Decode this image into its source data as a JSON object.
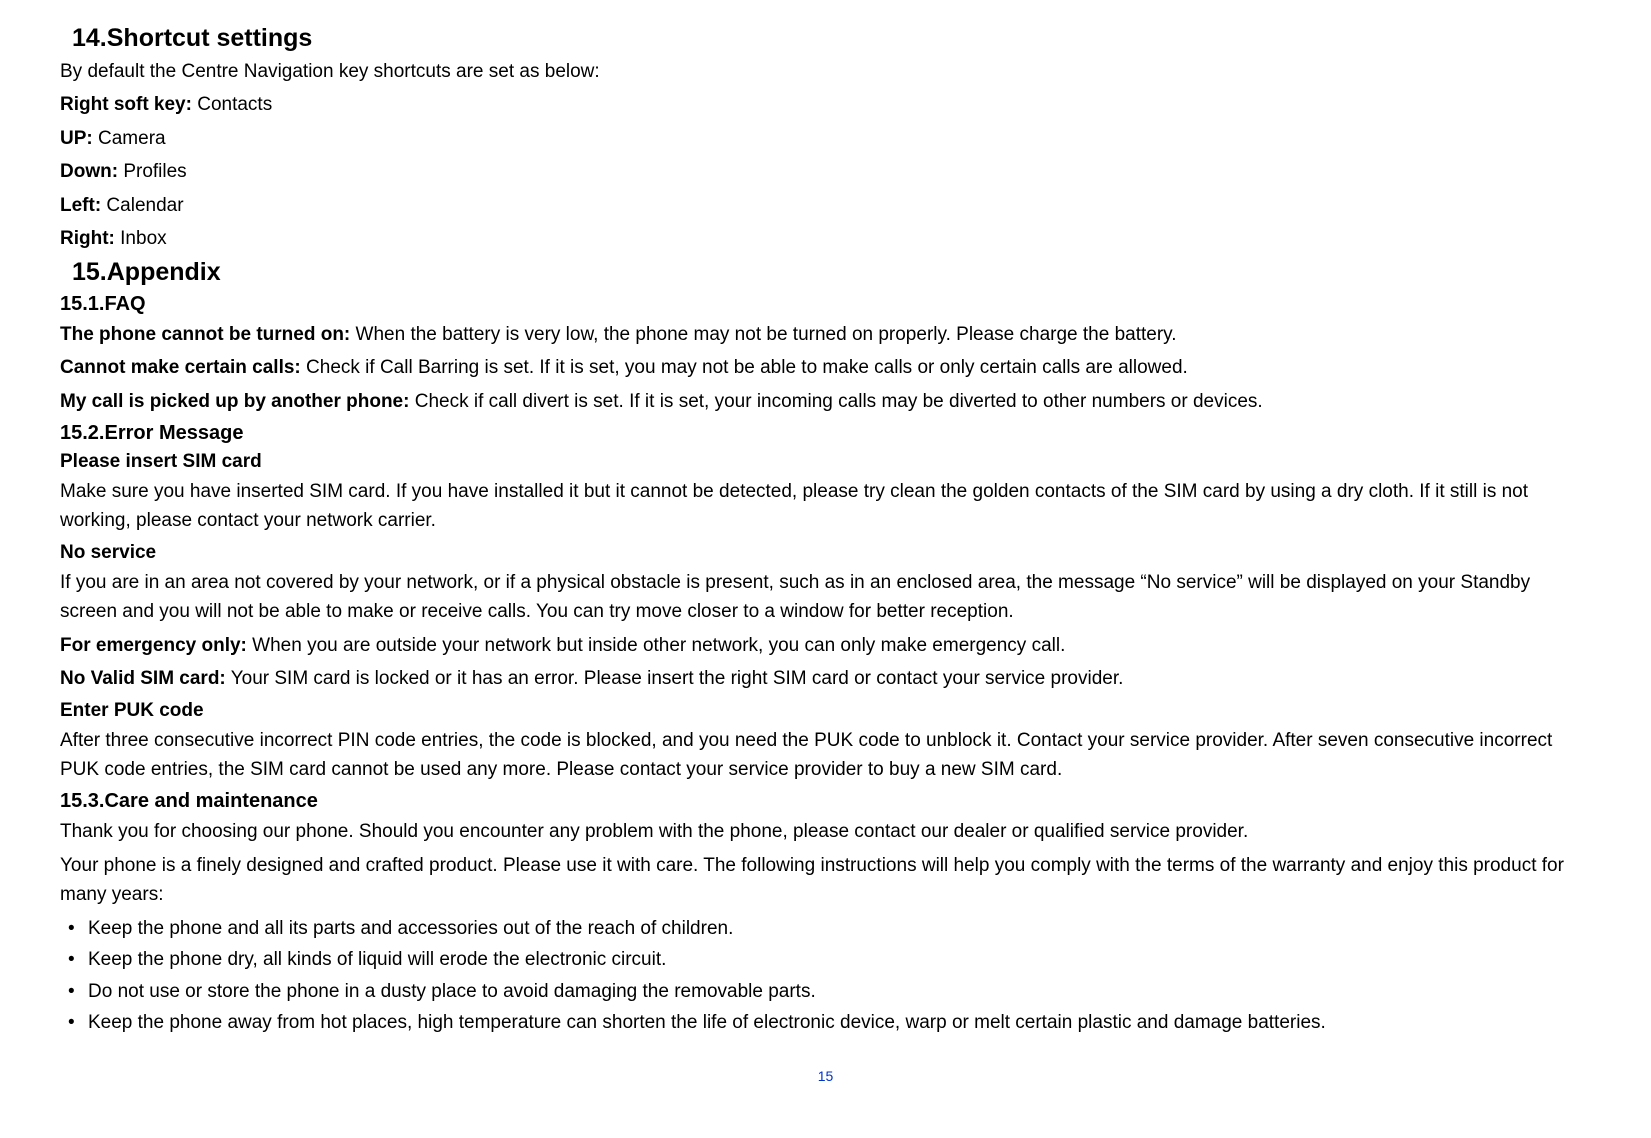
{
  "s14": {
    "title": "14.Shortcut  settings",
    "intro": "By default the Centre Navigation key shortcuts are set as below:",
    "rows": [
      {
        "label": "Right soft key:",
        "value": " Contacts"
      },
      {
        "label": "UP:",
        "value": " Camera"
      },
      {
        "label": "Down:",
        "value": " Profiles"
      },
      {
        "label": "Left:",
        "value": " Calendar"
      },
      {
        "label": "Right:",
        "value": " Inbox"
      }
    ]
  },
  "s15": {
    "title": "15.Appendix",
    "faq": {
      "heading": "15.1.FAQ",
      "items": [
        {
          "label": "The phone cannot be turned on:",
          "text": " When the battery is very low, the phone may not be turned on properly. Please charge the battery."
        },
        {
          "label": "Cannot make certain calls:",
          "text": " Check if Call Barring is set. If it is set, you may not be able to make calls or only certain calls are allowed."
        },
        {
          "label": "My call is picked up by another phone:",
          "text": " Check if call divert is set. If it is set, your incoming calls may be diverted to other numbers or devices."
        }
      ]
    },
    "err": {
      "heading": "15.2.Error Message",
      "sim": {
        "heading": "Please insert SIM card",
        "text": "Make sure you have inserted SIM card. If you have installed it but it cannot be detected, please try clean the golden contacts of the SIM card by using a dry cloth. If it still is not working, please contact your network carrier."
      },
      "noservice": {
        "heading": "No service",
        "text": "If you are in an area not covered by your network, or if a physical obstacle is present, such as in an enclosed area, the message “No service” will be displayed on your Standby screen and you will not be able to make or receive calls. You can try move closer to a window for better reception."
      },
      "emergency": {
        "label": "For emergency only:",
        "text": " When you are outside your network but inside other network, you can only make emergency call."
      },
      "novalid": {
        "label": "No Valid SIM card:",
        "text": " Your SIM card is locked or it has an error. Please insert the right SIM card or contact your service provider."
      },
      "puk": {
        "heading": "Enter PUK code",
        "text": "After three consecutive incorrect PIN code entries, the code is blocked, and you need the PUK code to unblock it. Contact your service provider. After seven consecutive incorrect PUK code entries, the SIM card cannot be used any more. Please contact your service provider to buy a new SIM card."
      }
    },
    "care": {
      "heading": "15.3.Care and maintenance",
      "p1": "Thank you for choosing our phone. Should you encounter any problem with the phone, please contact our dealer or qualified service provider.",
      "p2": "Your phone is a finely designed and crafted product. Please use it with care. The following instructions will help you comply with the terms of the warranty and enjoy this product for many years:",
      "bullets": [
        "Keep the phone and all its parts and accessories out of the reach of children.",
        "Keep the phone dry, all kinds of liquid will erode the electronic circuit.",
        "Do not use or store the phone in a dusty place to avoid damaging the removable parts.",
        "Keep the phone away from hot places, high temperature can shorten the life of electronic device, warp or melt certain plastic and damage batteries."
      ]
    }
  },
  "page_number": "15"
}
